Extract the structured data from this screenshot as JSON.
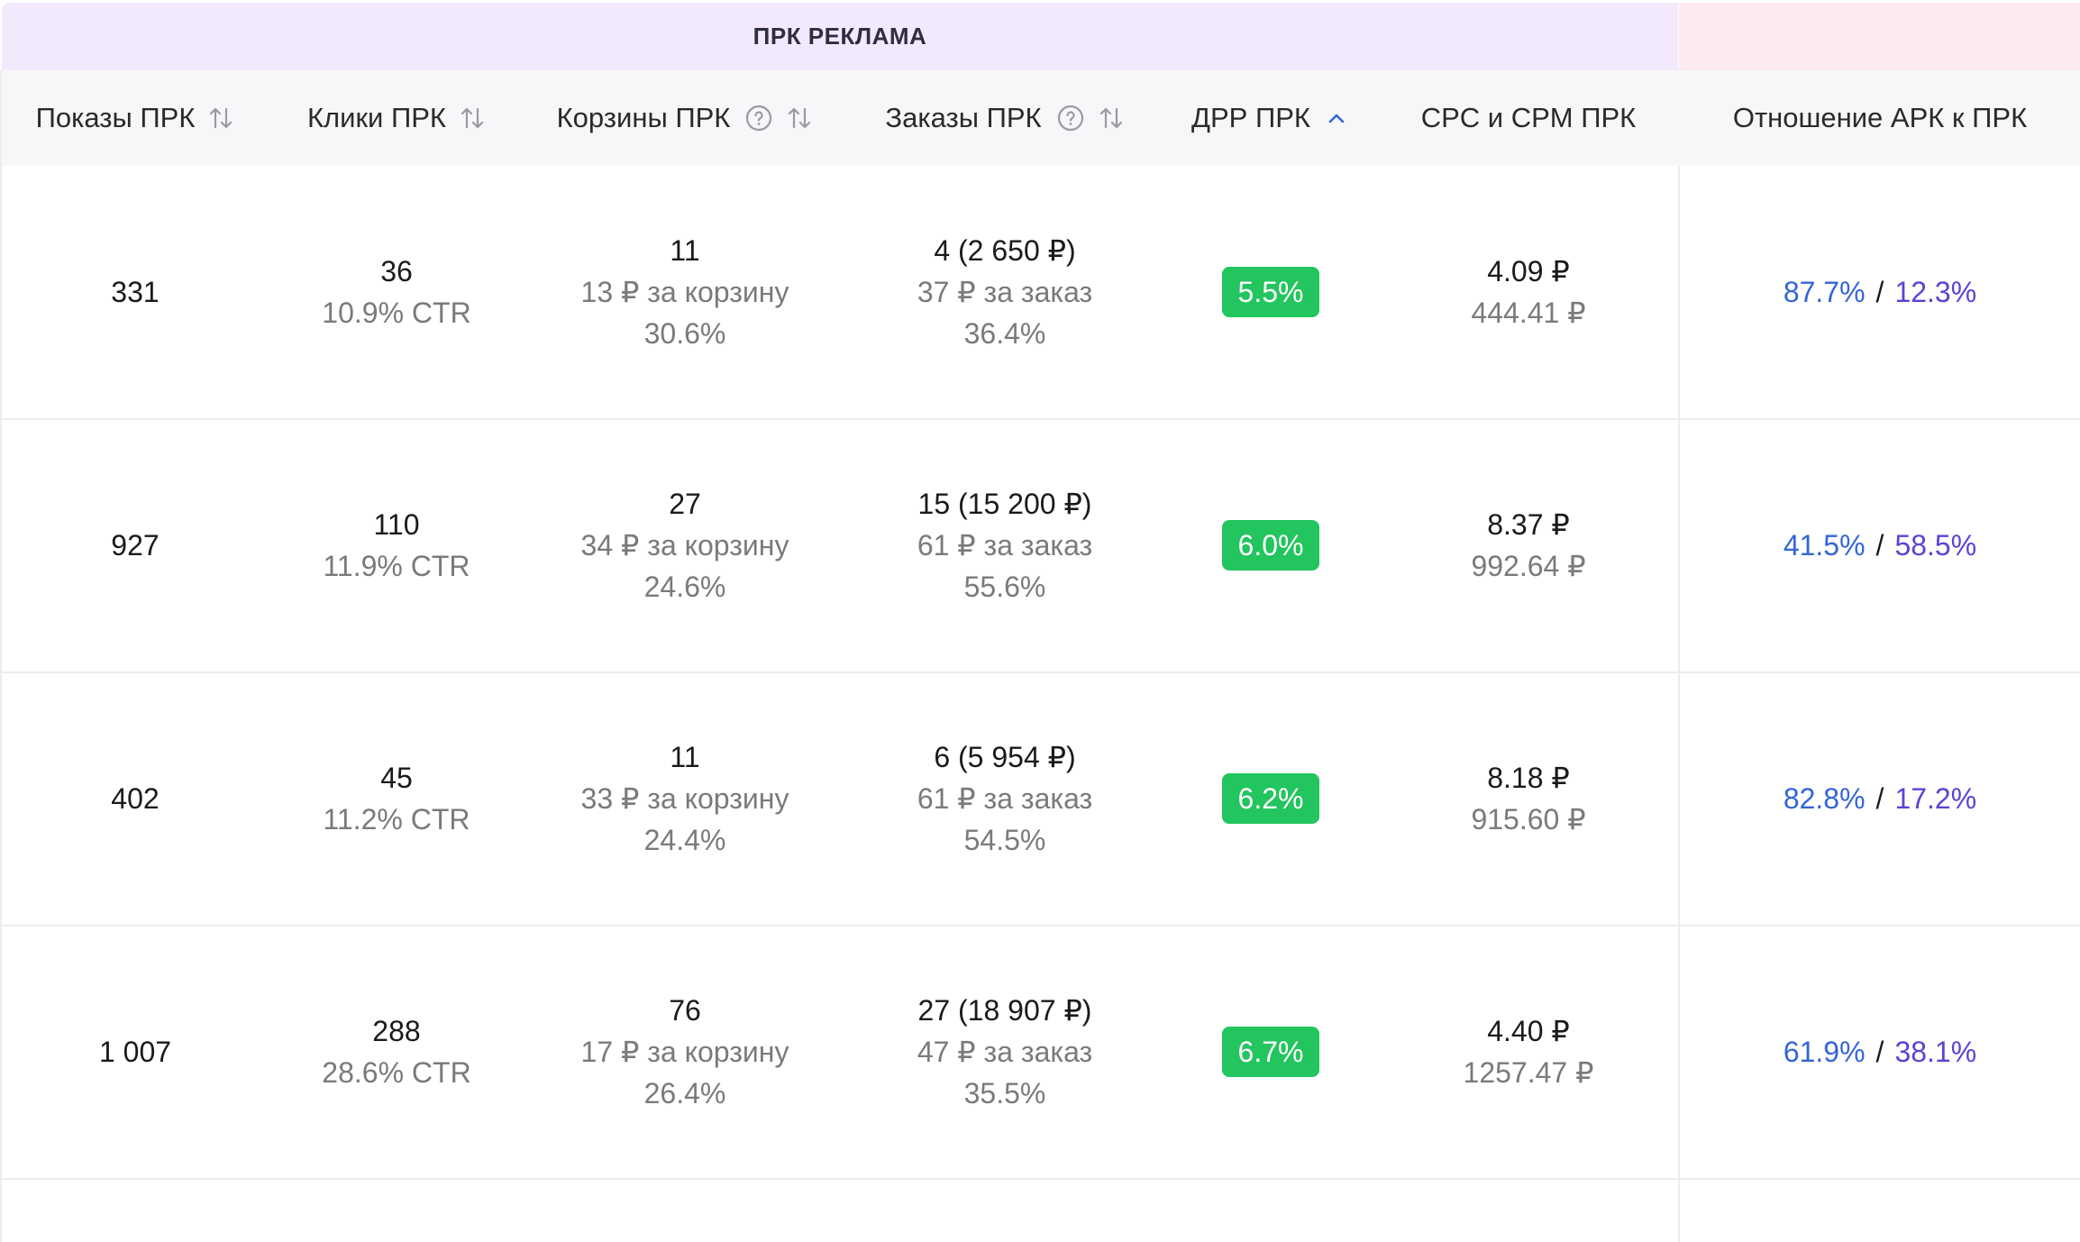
{
  "group_header": {
    "prk_title": "ПРК РЕКЛАМА"
  },
  "columns": {
    "impressions": "Показы ПРК",
    "clicks": "Клики ПРК",
    "carts": "Корзины ПРК",
    "orders": "Заказы ПРК",
    "drr": "ДРР ПРК",
    "cpc_cpm": "CPC и CPM ПРК",
    "ratio": "Отношение АРК к ПРК"
  },
  "rows": [
    {
      "impressions": "331",
      "clicks": "36",
      "ctr": "10.9% CTR",
      "carts": "11",
      "cart_cost": "13 ₽ за корзину",
      "cart_pct": "30.6%",
      "orders": "4 (2 650 ₽)",
      "order_cost": "37 ₽ за заказ",
      "order_pct": "36.4%",
      "drr": "5.5%",
      "cpc": "4.09 ₽",
      "cpm": "444.41 ₽",
      "ark": "87.7%",
      "sep": "/",
      "prk": "12.3%"
    },
    {
      "impressions": "927",
      "clicks": "110",
      "ctr": "11.9% CTR",
      "carts": "27",
      "cart_cost": "34 ₽ за корзину",
      "cart_pct": "24.6%",
      "orders": "15 (15 200 ₽)",
      "order_cost": "61 ₽ за заказ",
      "order_pct": "55.6%",
      "drr": "6.0%",
      "cpc": "8.37 ₽",
      "cpm": "992.64 ₽",
      "ark": "41.5%",
      "sep": "/",
      "prk": "58.5%"
    },
    {
      "impressions": "402",
      "clicks": "45",
      "ctr": "11.2% CTR",
      "carts": "11",
      "cart_cost": "33 ₽ за корзину",
      "cart_pct": "24.4%",
      "orders": "6 (5 954 ₽)",
      "order_cost": "61 ₽ за заказ",
      "order_pct": "54.5%",
      "drr": "6.2%",
      "cpc": "8.18 ₽",
      "cpm": "915.60 ₽",
      "ark": "82.8%",
      "sep": "/",
      "prk": "17.2%"
    },
    {
      "impressions": "1 007",
      "clicks": "288",
      "ctr": "28.6% CTR",
      "carts": "76",
      "cart_cost": "17 ₽ за корзину",
      "cart_pct": "26.4%",
      "orders": "27 (18 907 ₽)",
      "order_cost": "47 ₽ за заказ",
      "order_pct": "35.5%",
      "drr": "6.7%",
      "cpc": "4.40 ₽",
      "cpm": "1257.47 ₽",
      "ark": "61.9%",
      "sep": "/",
      "prk": "38.1%"
    }
  ],
  "colors": {
    "group_prk_bg": "#f3e9fd",
    "group_ark_bg": "#fde9f0",
    "badge_green": "#22c55e",
    "ark_blue": "#3465d8",
    "prk_purple": "#5b43d6"
  },
  "icons": {
    "sort": "sort-arrows-icon",
    "help": "help-circle-icon",
    "sort_active": "chevron-up-icon"
  }
}
